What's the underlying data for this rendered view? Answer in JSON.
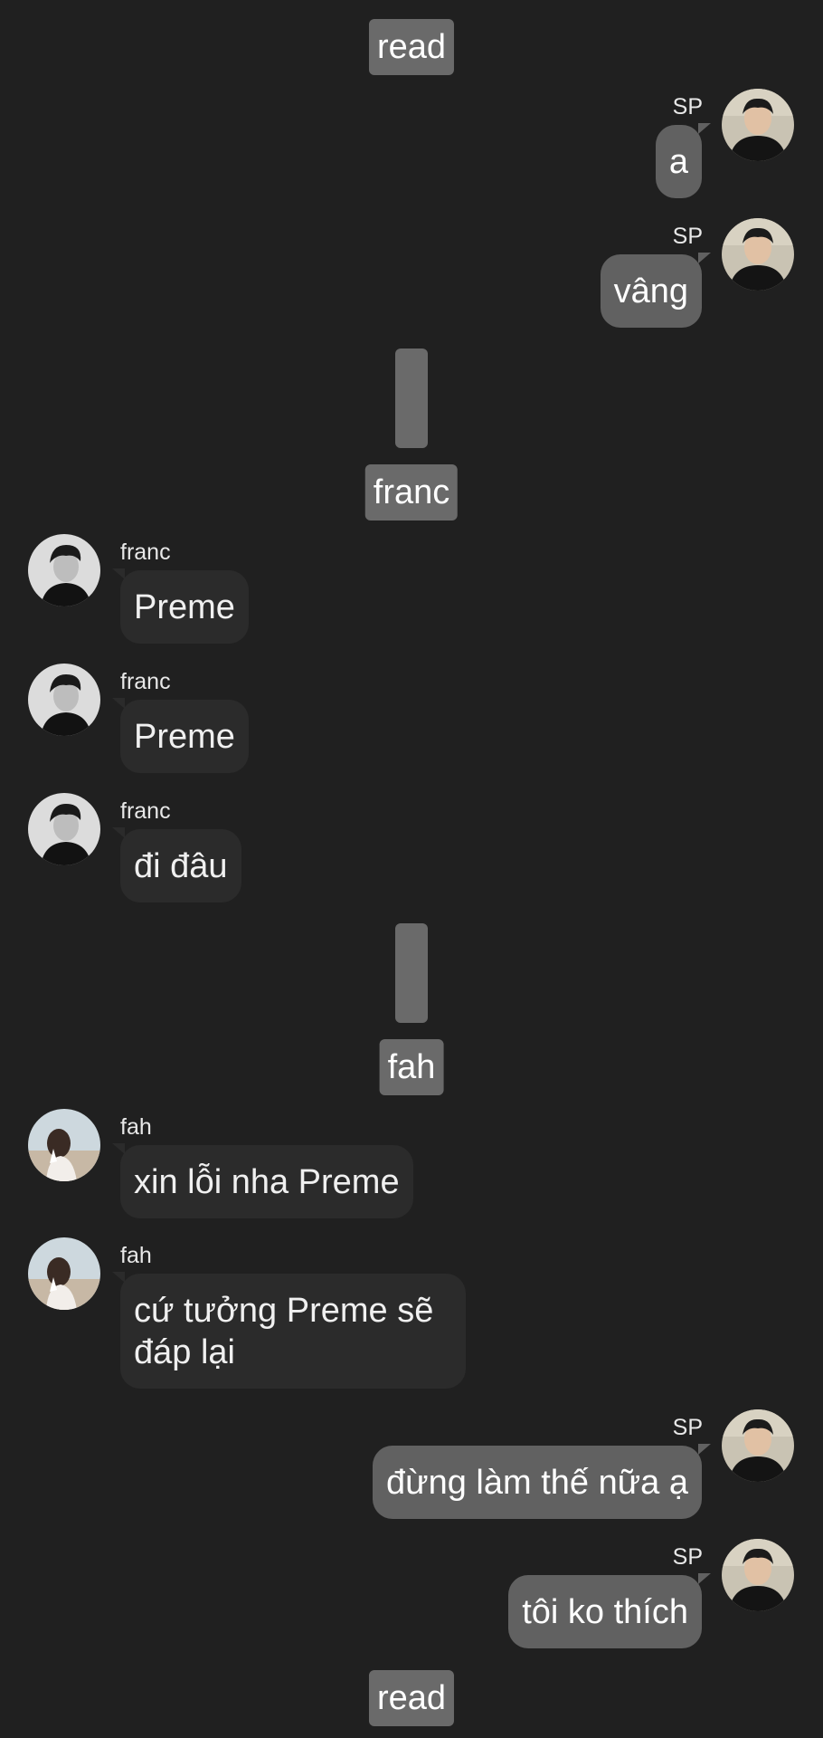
{
  "separators": {
    "top": "read",
    "franc": "franc",
    "fah": "fah",
    "bottom": "read"
  },
  "messages": [
    {
      "side": "right",
      "sender": "SP",
      "text": "a"
    },
    {
      "side": "right",
      "sender": "SP",
      "text": "vâng"
    },
    {
      "side": "left",
      "sender": "franc",
      "text": "Preme"
    },
    {
      "side": "left",
      "sender": "franc",
      "text": "Preme"
    },
    {
      "side": "left",
      "sender": "franc",
      "text": "đi đâu"
    },
    {
      "side": "left",
      "sender": "fah",
      "text": "xin lỗi nha Preme"
    },
    {
      "side": "left",
      "sender": "fah",
      "text": "cứ tưởng Preme sẽ đáp lại"
    },
    {
      "side": "right",
      "sender": "SP",
      "text": "đừng làm thế nữa ạ"
    },
    {
      "side": "right",
      "sender": "SP",
      "text": "tôi ko thích"
    }
  ],
  "colors": {
    "background": "#202020",
    "incoming_bubble": "#2b2b2b",
    "outgoing_bubble": "#616161",
    "separator": "#6a6a6a"
  },
  "avatars": {
    "SP": "sp-avatar-icon",
    "franc": "franc-avatar-icon",
    "fah": "fah-avatar-icon"
  }
}
